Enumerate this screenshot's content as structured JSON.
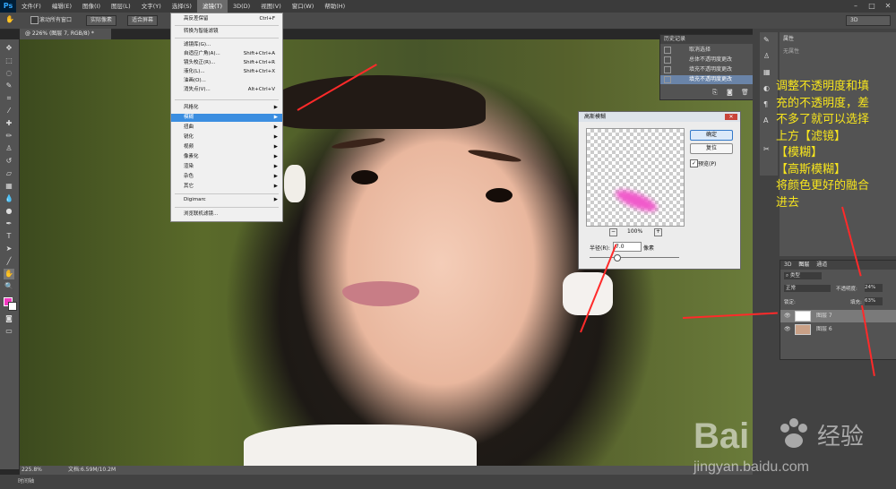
{
  "menubar": {
    "logo": "Ps",
    "items": [
      "文件(F)",
      "编辑(E)",
      "图像(I)",
      "图层(L)",
      "文字(Y)",
      "选择(S)",
      "滤镜(T)",
      "3D(D)",
      "视图(V)",
      "窗口(W)",
      "帮助(H)"
    ],
    "active_index": 6
  },
  "options": {
    "scroll_all_windows": "滚动所有窗口",
    "actual_pixels": "实际像素",
    "fit_screen": "适合屏幕",
    "workspace": "3D"
  },
  "document_tab": "@ 226% (图层 7, RGB/8) *",
  "filter_menu": {
    "items": [
      {
        "label": "高反差保留",
        "shortcut": "Ctrl+F"
      },
      {
        "label": "转换为智能滤镜",
        "shortcut": ""
      },
      {
        "label": "滤镜库(G)...",
        "shortcut": ""
      },
      {
        "label": "自适应广角(A)...",
        "shortcut": "Shift+Ctrl+A"
      },
      {
        "label": "镜头校正(R)...",
        "shortcut": "Shift+Ctrl+R"
      },
      {
        "label": "液化(L)...",
        "shortcut": "Shift+Ctrl+X"
      },
      {
        "label": "油画(O)...",
        "shortcut": ""
      },
      {
        "label": "消失点(V)...",
        "shortcut": "Alt+Ctrl+V"
      },
      {
        "label": "风格化",
        "shortcut": ""
      },
      {
        "label": "模糊",
        "shortcut": ""
      },
      {
        "label": "扭曲",
        "shortcut": ""
      },
      {
        "label": "锐化",
        "shortcut": ""
      },
      {
        "label": "视频",
        "shortcut": ""
      },
      {
        "label": "像素化",
        "shortcut": ""
      },
      {
        "label": "渲染",
        "shortcut": ""
      },
      {
        "label": "杂色",
        "shortcut": ""
      },
      {
        "label": "其它",
        "shortcut": ""
      },
      {
        "label": "Digimarc",
        "shortcut": ""
      },
      {
        "label": "浏览联机滤镜...",
        "shortcut": ""
      }
    ]
  },
  "history": {
    "title": "历史记录",
    "items": [
      "取消选择",
      "总体不透明度更改",
      "填充不透明度更改",
      "填充不透明度更改"
    ],
    "selected_index": 3
  },
  "properties": {
    "title": "属性",
    "subtitle": "无属性"
  },
  "layers": {
    "tabs": [
      "3D",
      "图层",
      "通道"
    ],
    "kind_label": "类型",
    "blend_mode": "正常",
    "opacity_label": "不透明度:",
    "opacity_value": "24%",
    "lock_label": "锁定:",
    "fill_label": "填充:",
    "fill_value": "63%",
    "rows": [
      {
        "name": "图层 7"
      },
      {
        "name": "图层 6"
      }
    ],
    "selected_index": 0
  },
  "gaussian_blur": {
    "title": "高斯模糊",
    "ok": "确定",
    "reset": "复位",
    "preview_label": "预览(P)",
    "preview_checked": true,
    "zoom": "100%",
    "radius_label": "半径(R):",
    "radius_value": "7.0",
    "unit": "像素",
    "slider_fraction": 0.3,
    "blob_color": "#f15acb"
  },
  "annotation": {
    "lines": [
      "调整不透明度和填",
      "充的不透明度，差",
      "不多了就可以选择",
      "上方【滤镜】",
      "【模糊】",
      "【高斯模糊】",
      "将颜色更好的融合",
      "进去"
    ],
    "color": "#f7e51d"
  },
  "status": {
    "zoom": "225.8%",
    "doc": "文档:6.59M/10.2M"
  },
  "timeline_label": "时间轴",
  "watermark": {
    "brand": "Bai",
    "brand2": "经验",
    "url": "jingyan.baidu.com"
  }
}
